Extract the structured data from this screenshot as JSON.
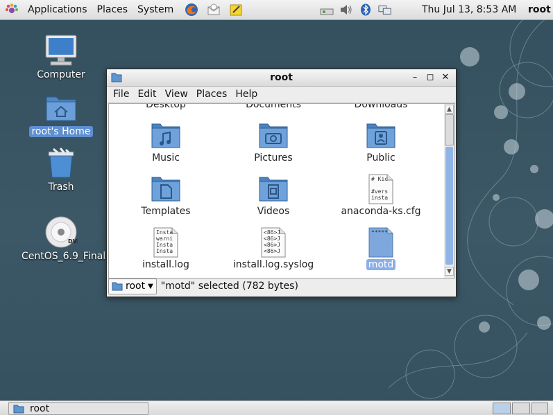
{
  "top_panel": {
    "menus": [
      "Applications",
      "Places",
      "System"
    ],
    "clock": "Thu Jul 13,  8:53 AM",
    "user": "root"
  },
  "desktop_icons": {
    "computer": "Computer",
    "home": "root's Home",
    "trash": "Trash",
    "dvd": "CentOS_6.9_Final",
    "dvd_badge": "DVD"
  },
  "window": {
    "title": "root",
    "menu": [
      "File",
      "Edit",
      "View",
      "Places",
      "Help"
    ],
    "partial_row": [
      "Desktop",
      "Documents",
      "Downloads"
    ],
    "files": [
      {
        "label": "Music"
      },
      {
        "label": "Pictures"
      },
      {
        "label": "Public"
      },
      {
        "label": "Templates"
      },
      {
        "label": "Videos"
      },
      {
        "label": "anaconda-ks.cfg",
        "preview": [
          "# Kic",
          "",
          "#vers",
          "insta"
        ]
      },
      {
        "label": "install.log",
        "preview": [
          "Insta",
          "warni",
          "Insta",
          "Insta"
        ]
      },
      {
        "label": "install.log.syslog",
        "preview": [
          "<86>J",
          "<86>J",
          "<86>J",
          "<86>J"
        ]
      },
      {
        "label": "motd",
        "preview": [
          "*****"
        ]
      }
    ],
    "location": "root",
    "status": "\"motd\" selected (782 bytes)"
  },
  "taskbar": {
    "task_label": "root"
  },
  "colors": {
    "desktop_bg": "#34505f",
    "folder_blue": "#5f95cf",
    "selection": "#8aaee6"
  }
}
